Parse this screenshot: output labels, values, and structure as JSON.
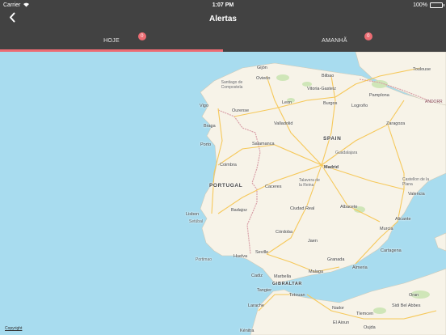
{
  "status_bar": {
    "carrier": "Carrier",
    "time": "1:07 PM",
    "battery_percent": "100%",
    "battery_level": 1.0
  },
  "nav": {
    "title": "Alertas",
    "back_icon": "chevron-left-icon"
  },
  "tabs": [
    {
      "label": "HOJE",
      "badge": "0",
      "active": true
    },
    {
      "label": "AMANHÃ",
      "badge": "0",
      "active": false
    }
  ],
  "map": {
    "colors": {
      "sea": "#a8dcef",
      "land": "#f7f3e8",
      "road": "#f6c85a",
      "border": "#d9a0a8"
    },
    "labels": {
      "gijon": "Gijón",
      "oviedo": "Oviedo",
      "bilbao": "Bilbao",
      "toulouse": "Toulouse",
      "santiago": "Santiago de Compostela",
      "vitoria": "Vitoria-Gasteiz",
      "pamplona": "Pamplona",
      "vigo": "Vigo",
      "ourense": "Ourense",
      "leon": "Leon",
      "burgos": "Burgos",
      "logrono": "Logroño",
      "andorra": "ANDORR",
      "braga": "Braga",
      "valladolid": "Valladolid",
      "zaragoza": "Zaragoza",
      "porto": "Porto",
      "spain": "SPAIN",
      "salamanca": "Salamanca",
      "guadalajara": "Guadalajara",
      "coimbra": "Coimbra",
      "madrid": "Madrid",
      "castellon": "Castellon de la Plana",
      "portugal": "PORTUGAL",
      "caceres": "Caceres",
      "talavera": "Talavera de la Reina",
      "valencia": "Valencia",
      "lisbon": "Lisbon",
      "setubal": "Setúbal",
      "badajoz": "Badajoz",
      "ciudad_real": "Ciudad Real",
      "albacete": "Albacete",
      "alicante": "Alicante",
      "cordoba": "Córdoba",
      "murcia": "Murcia",
      "jaen": "Jaen",
      "cartagena": "Cartagena",
      "portimao": "Portimao",
      "huelva": "Huelva",
      "seville": "Seville",
      "granada": "Granada",
      "almeria": "Almeria",
      "cadiz": "Cadiz",
      "marbella": "Marbella",
      "malaga": "Malaga",
      "gibraltar": "GIBRALTAR",
      "tangier": "Tangier",
      "tetouan": "Tetouan",
      "oran": "Oran",
      "larache": "Larache",
      "nador": "Nador",
      "tlemcen": "Tlemcen",
      "sidi_bel_abbes": "Sidi Bel Abbes",
      "kenitra": "Kénitra",
      "el_aioun": "El Aioun",
      "oujda": "Oujda"
    },
    "copyright": "Copyright"
  }
}
